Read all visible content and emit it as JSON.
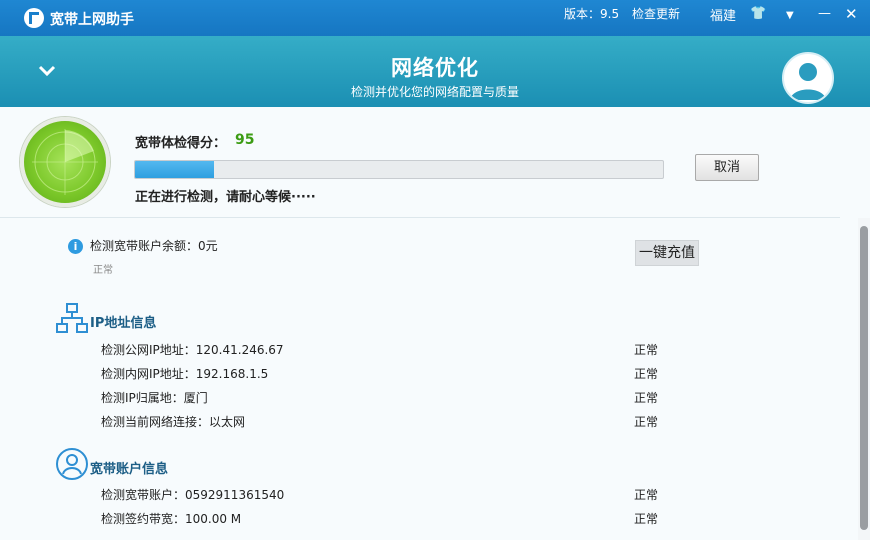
{
  "titlebar": {
    "app_title": "宽带上网助手",
    "version": "版本：9.5",
    "check_update": "检查更新",
    "region": "福建",
    "shirt_glyph": "👕",
    "dropdown_glyph": "▼",
    "minimize_glyph": "—",
    "close_glyph": "✕"
  },
  "header": {
    "title": "网络优化",
    "subtitle": "检测并优化您的网络配置与质量"
  },
  "score": {
    "label": "宽带体检得分：",
    "value": "95",
    "progress_percent": 15,
    "status_text": "正在进行检测，请耐心等候·····",
    "cancel_label": "取消"
  },
  "balance": {
    "text": "检测宽带账户余额：0元",
    "note": "正常",
    "recharge_label": "一键充值"
  },
  "ip_section": {
    "title": "IP地址信息",
    "rows": [
      {
        "text": "检测公网IP地址：120.41.246.67",
        "status": "正常"
      },
      {
        "text": "检测内网IP地址：192.168.1.5",
        "status": "正常"
      },
      {
        "text": "检测IP归属地：厦门",
        "status": "正常"
      },
      {
        "text": "检测当前网络连接：以太网",
        "status": "正常"
      }
    ]
  },
  "account_section": {
    "title": "宽带账户信息",
    "rows": [
      {
        "text": "检测宽带账户：0592911361540",
        "status": "正常"
      },
      {
        "text": "检测签约带宽：100.00 M",
        "status": "正常"
      }
    ]
  }
}
